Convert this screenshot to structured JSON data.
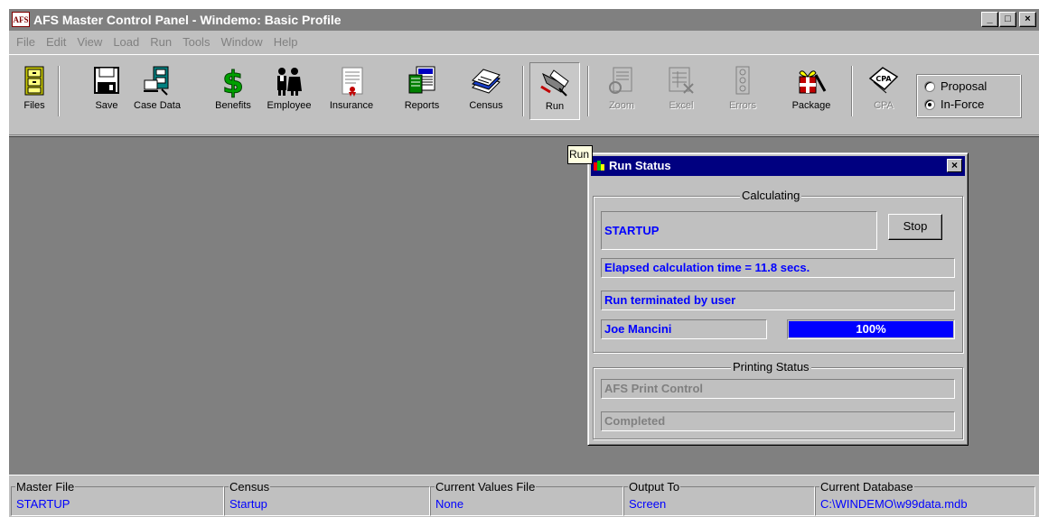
{
  "window": {
    "logo_text": "AFS",
    "title": "AFS Master Control Panel - Windemo: Basic Profile",
    "minimize": "_",
    "maximize": "□",
    "close": "×"
  },
  "menu": [
    "File",
    "Edit",
    "View",
    "Load",
    "Run",
    "Tools",
    "Window",
    "Help"
  ],
  "toolbar": {
    "files": "Files",
    "save": "Save",
    "case_data": "Case Data",
    "benefits": "Benefits",
    "employee": "Employee",
    "insurance": "Insurance",
    "reports": "Reports",
    "census": "Census",
    "run": "Run",
    "zoom": "Zoom",
    "excel": "Excel",
    "errors": "Errors",
    "package": "Package",
    "cpa": "CPA",
    "cpa_icon_text": "CPA",
    "mode_options": [
      "Proposal",
      "In-Force"
    ],
    "mode_selected": "In-Force"
  },
  "tooltip": "Run",
  "run_status": {
    "title": "Run Status",
    "close": "×",
    "calculating_label": "Calculating",
    "current_step": "STARTUP",
    "stop_label": "Stop",
    "elapsed": "Elapsed calculation time = 11.8 secs.",
    "message": "Run terminated by user",
    "employee": "Joe Mancini",
    "progress_percent": 100,
    "progress_text": "100%",
    "printing_label": "Printing Status",
    "print_control": "AFS Print Control",
    "print_state": "Completed"
  },
  "statusbar": [
    {
      "label": "Master File",
      "value": "STARTUP"
    },
    {
      "label": "Census",
      "value": "Startup"
    },
    {
      "label": "Current Values File",
      "value": "None"
    },
    {
      "label": "Output To",
      "value": "Screen"
    },
    {
      "label": "Current Database",
      "value": "C:\\WINDEMO\\w99data.mdb"
    }
  ],
  "colors": {
    "title_active": "#000080",
    "title_inactive": "#808080",
    "value_text": "#0000ff",
    "face": "#c0c0c0"
  }
}
